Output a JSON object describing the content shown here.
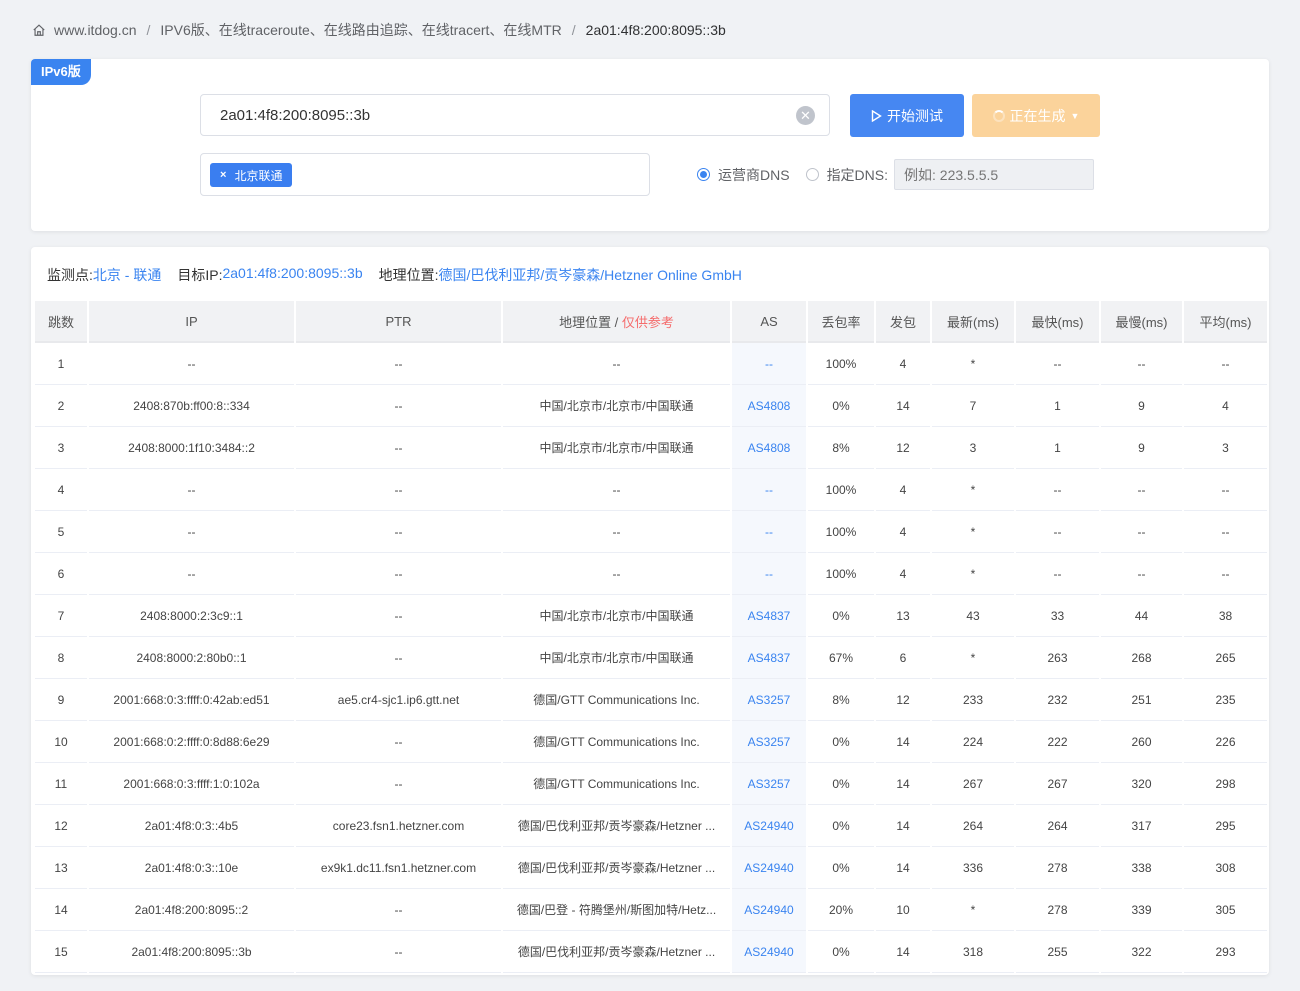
{
  "breadcrumb": {
    "items": [
      "www.itdog.cn",
      "IPV6版、在线traceroute、在线路由追踪、在线tracert、在线MTR",
      "2a01:4f8:200:8095::3b"
    ]
  },
  "form": {
    "badge": "IPv6版",
    "target_value": "2a01:4f8:200:8095::3b",
    "start_label": "开始测试",
    "generate_label": "正在生成",
    "node_chip": "北京联通",
    "dns_option_isp": "运营商DNS",
    "dns_option_custom": "指定DNS:",
    "dns_placeholder": "例如: 223.5.5.5"
  },
  "result_info": {
    "monitor_label": "监测点:",
    "monitor_value": "北京 - 联通",
    "target_label": "目标IP:",
    "target_value": "2a01:4f8:200:8095::3b",
    "geo_label": "地理位置:",
    "geo_value": "德国/巴伐利亚邦/贡岑豪森/Hetzner Online GmbH"
  },
  "table": {
    "headers": {
      "hop": "跳数",
      "ip": "IP",
      "ptr": "PTR",
      "geo": "地理位置 / ",
      "geo_note": "仅供参考",
      "as": "AS",
      "loss": "丢包率",
      "sent": "发包",
      "last": "最新(ms)",
      "best": "最快(ms)",
      "worst": "最慢(ms)",
      "avg": "平均(ms)"
    },
    "rows": [
      {
        "hop": "1",
        "ip": "--",
        "ptr": "--",
        "geo": "--",
        "as": "--",
        "loss": "100%",
        "sent": "4",
        "last": "*",
        "best": "--",
        "worst": "--",
        "avg": "--"
      },
      {
        "hop": "2",
        "ip": "2408:870b:ff00:8::334",
        "ptr": "--",
        "geo": "中国/北京市/北京市/中国联通",
        "as": "AS4808",
        "loss": "0%",
        "sent": "14",
        "last": "7",
        "best": "1",
        "worst": "9",
        "avg": "4"
      },
      {
        "hop": "3",
        "ip": "2408:8000:1f10:3484::2",
        "ptr": "--",
        "geo": "中国/北京市/北京市/中国联通",
        "as": "AS4808",
        "loss": "8%",
        "sent": "12",
        "last": "3",
        "best": "1",
        "worst": "9",
        "avg": "3"
      },
      {
        "hop": "4",
        "ip": "--",
        "ptr": "--",
        "geo": "--",
        "as": "--",
        "loss": "100%",
        "sent": "4",
        "last": "*",
        "best": "--",
        "worst": "--",
        "avg": "--"
      },
      {
        "hop": "5",
        "ip": "--",
        "ptr": "--",
        "geo": "--",
        "as": "--",
        "loss": "100%",
        "sent": "4",
        "last": "*",
        "best": "--",
        "worst": "--",
        "avg": "--"
      },
      {
        "hop": "6",
        "ip": "--",
        "ptr": "--",
        "geo": "--",
        "as": "--",
        "loss": "100%",
        "sent": "4",
        "last": "*",
        "best": "--",
        "worst": "--",
        "avg": "--"
      },
      {
        "hop": "7",
        "ip": "2408:8000:2:3c9::1",
        "ptr": "--",
        "geo": "中国/北京市/北京市/中国联通",
        "as": "AS4837",
        "loss": "0%",
        "sent": "13",
        "last": "43",
        "best": "33",
        "worst": "44",
        "avg": "38"
      },
      {
        "hop": "8",
        "ip": "2408:8000:2:80b0::1",
        "ptr": "--",
        "geo": "中国/北京市/北京市/中国联通",
        "as": "AS4837",
        "loss": "67%",
        "sent": "6",
        "last": "*",
        "best": "263",
        "worst": "268",
        "avg": "265"
      },
      {
        "hop": "9",
        "ip": "2001:668:0:3:ffff:0:42ab:ed51",
        "ptr": "ae5.cr4-sjc1.ip6.gtt.net",
        "geo": "德国/GTT Communications Inc.",
        "as": "AS3257",
        "loss": "8%",
        "sent": "12",
        "last": "233",
        "best": "232",
        "worst": "251",
        "avg": "235"
      },
      {
        "hop": "10",
        "ip": "2001:668:0:2:ffff:0:8d88:6e29",
        "ptr": "--",
        "geo": "德国/GTT Communications Inc.",
        "as": "AS3257",
        "loss": "0%",
        "sent": "14",
        "last": "224",
        "best": "222",
        "worst": "260",
        "avg": "226"
      },
      {
        "hop": "11",
        "ip": "2001:668:0:3:ffff:1:0:102a",
        "ptr": "--",
        "geo": "德国/GTT Communications Inc.",
        "as": "AS3257",
        "loss": "0%",
        "sent": "14",
        "last": "267",
        "best": "267",
        "worst": "320",
        "avg": "298"
      },
      {
        "hop": "12",
        "ip": "2a01:4f8:0:3::4b5",
        "ptr": "core23.fsn1.hetzner.com",
        "geo": "德国/巴伐利亚邦/贡岑豪森/Hetzner ...",
        "as": "AS24940",
        "loss": "0%",
        "sent": "14",
        "last": "264",
        "best": "264",
        "worst": "317",
        "avg": "295"
      },
      {
        "hop": "13",
        "ip": "2a01:4f8:0:3::10e",
        "ptr": "ex9k1.dc11.fsn1.hetzner.com",
        "geo": "德国/巴伐利亚邦/贡岑豪森/Hetzner ...",
        "as": "AS24940",
        "loss": "0%",
        "sent": "14",
        "last": "336",
        "best": "278",
        "worst": "338",
        "avg": "308"
      },
      {
        "hop": "14",
        "ip": "2a01:4f8:200:8095::2",
        "ptr": "--",
        "geo": "德国/巴登 - 符腾堡州/斯图加特/Hetz...",
        "as": "AS24940",
        "loss": "20%",
        "sent": "10",
        "last": "*",
        "best": "278",
        "worst": "339",
        "avg": "305"
      },
      {
        "hop": "15",
        "ip": "2a01:4f8:200:8095::3b",
        "ptr": "--",
        "geo": "德国/巴伐利亚邦/贡岑豪森/Hetzner ...",
        "as": "AS24940",
        "loss": "0%",
        "sent": "14",
        "last": "318",
        "best": "255",
        "worst": "322",
        "avg": "293"
      }
    ]
  },
  "colors": {
    "accent": "#3a84f0",
    "warning_button": "#fbd39b",
    "note_red": "#f56c6c"
  }
}
